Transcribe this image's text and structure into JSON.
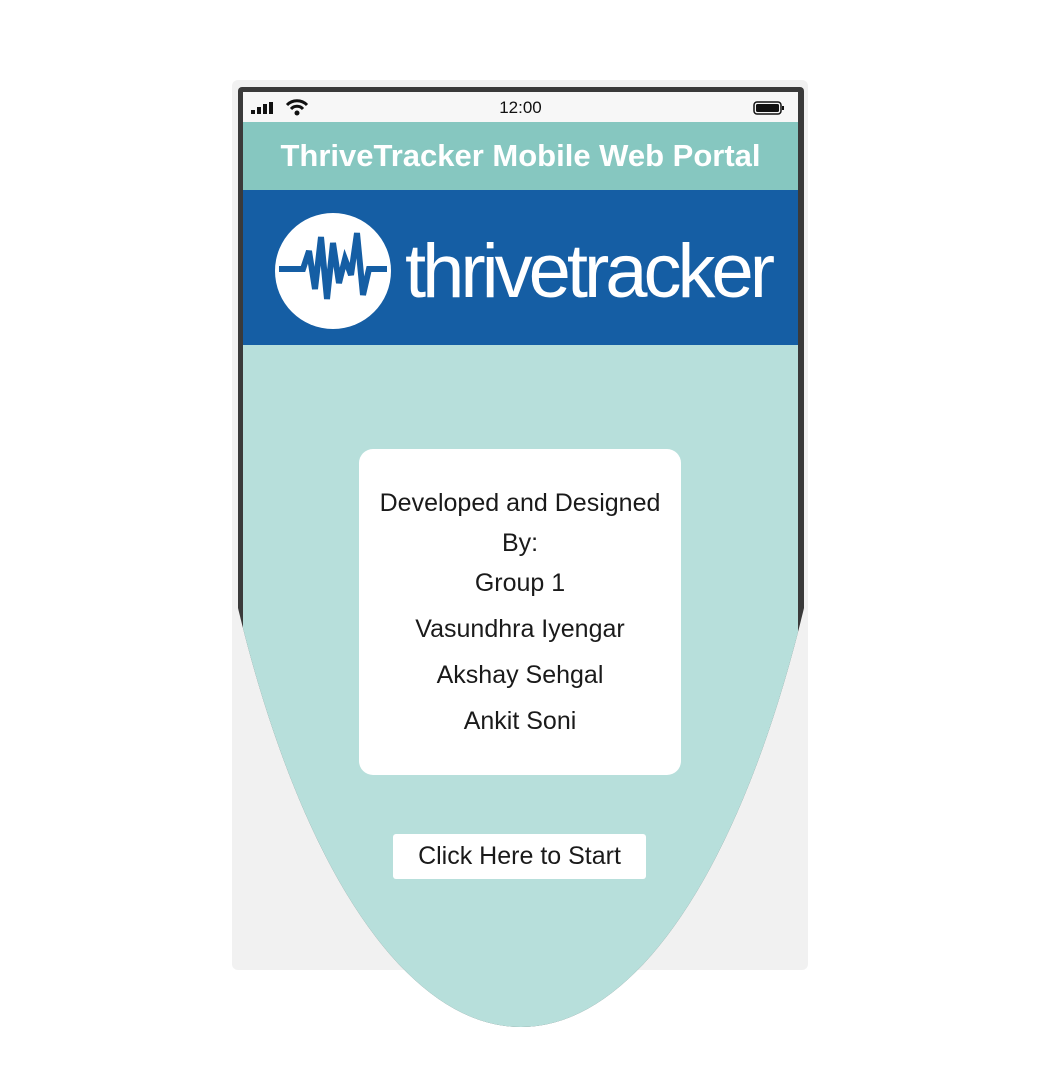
{
  "status_bar": {
    "time": "12:00",
    "signal_icon": "cellular-signal-icon",
    "wifi_icon": "wifi-icon",
    "battery_icon": "battery-icon"
  },
  "header": {
    "title": "ThriveTracker Mobile Web Portal",
    "background": "#86c7c0"
  },
  "logo": {
    "wordmark": "thrivetracker",
    "icon": "heartbeat-logo-icon",
    "background": "#155ea4"
  },
  "credits": {
    "heading": "Developed and Designed By:",
    "group": "Group 1",
    "members": [
      "Vasundhra Iyengar",
      "Akshay Sehgal",
      "Ankit Soni"
    ]
  },
  "start_button": {
    "label": "Click Here to Start"
  },
  "colors": {
    "screen_background": "#b7dfdb",
    "card": "#ffffff",
    "text": "#1a1a1a"
  }
}
